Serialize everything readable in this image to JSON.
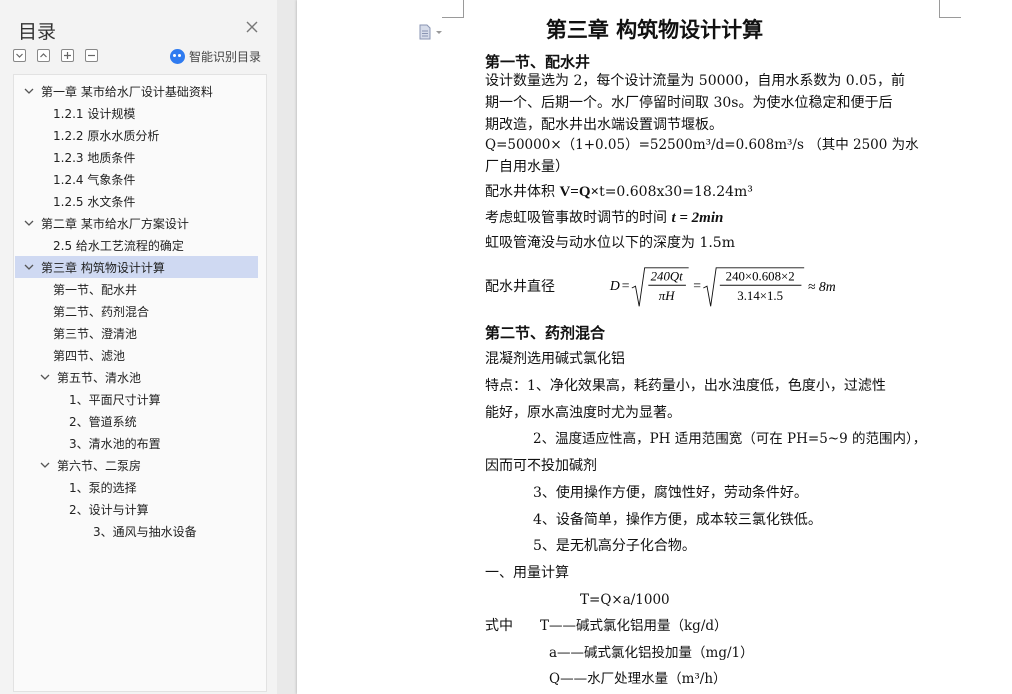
{
  "toc": {
    "title": "目录",
    "smart_label": "智能识别目录",
    "items": [
      {
        "label": "第一章   某市给水厂设计基础资料",
        "level": 0,
        "chevron": "down",
        "selected": false
      },
      {
        "label": "1.2.1 设计规模",
        "level": 1,
        "chevron": "",
        "selected": false
      },
      {
        "label": "1.2.2 原水水质分析",
        "level": 1,
        "chevron": "",
        "selected": false
      },
      {
        "label": "1.2.3 地质条件",
        "level": 1,
        "chevron": "",
        "selected": false
      },
      {
        "label": "1.2.4 气象条件",
        "level": 1,
        "chevron": "",
        "selected": false
      },
      {
        "label": "1.2.5 水文条件",
        "level": 1,
        "chevron": "",
        "selected": false
      },
      {
        "label": "第二章   某市给水厂方案设计",
        "level": 0,
        "chevron": "down",
        "selected": false
      },
      {
        "label": "2.5 给水工艺流程的确定",
        "level": 1,
        "chevron": "",
        "selected": false
      },
      {
        "label": "第三章  构筑物设计计算",
        "level": 0,
        "chevron": "down",
        "selected": true
      },
      {
        "label": "第一节、配水井",
        "level": 1,
        "chevron": "",
        "selected": false
      },
      {
        "label": "第二节、药剂混合",
        "level": 1,
        "chevron": "",
        "selected": false
      },
      {
        "label": "第三节、澄清池",
        "level": 1,
        "chevron": "",
        "selected": false
      },
      {
        "label": "第四节、滤池",
        "level": 1,
        "chevron": "",
        "selected": false
      },
      {
        "label": "第五节、清水池",
        "level": 1,
        "chevron": "down",
        "selected": false
      },
      {
        "label": "1、平面尺寸计算",
        "level": 2,
        "chevron": "",
        "selected": false
      },
      {
        "label": "2、管道系统",
        "level": 2,
        "chevron": "",
        "selected": false
      },
      {
        "label": "3、清水池的布置",
        "level": 2,
        "chevron": "",
        "selected": false
      },
      {
        "label": "第六节、二泵房",
        "level": 1,
        "chevron": "down",
        "selected": false
      },
      {
        "label": "1、泵的选择",
        "level": 2,
        "chevron": "",
        "selected": false
      },
      {
        "label": "2、设计与计算",
        "level": 2,
        "chevron": "",
        "selected": false
      },
      {
        "label": "3、通风与抽水设备",
        "level": 3,
        "chevron": "",
        "selected": false
      }
    ]
  },
  "doc": {
    "chapter_title": "第三章  构筑物设计计算",
    "section1_title": "第一节、配水井",
    "p1_l1": "设计数量选为 2，每个设计流量为 50000，自用水系数为 0.05，前",
    "p1_l2": "期一个、后期一个。水厂停留时间取 30s。为使水位稳定和便于后",
    "p1_l3": "期改造，配水井出水端设置调节堰板。",
    "q_l1": " Q=50000×（1+0.05）=52500m³/d=0.608m³/s （其中 2500 为水",
    "q_l2": "厂自用水量）",
    "volume_prefix": " 配水井体积 ",
    "volume_math": "V=Q×",
    "volume_rest": "t=0.608x30=18.24m³",
    "siphon_time_prefix": "考虑虹吸管事故时调节的时间 ",
    "siphon_time_math": "t = 2min",
    "siphon_depth": "虹吸管淹没与动水位以下的深度为 1.5m",
    "diameter_prefix": "配水井直径",
    "formula": {
      "lhs": "D",
      "eq": "=",
      "num1": "240Qt",
      "den1": "πH",
      "num2": "240×0.608×2",
      "den2": "3.14×1.5",
      "approx": "≈ 8m"
    },
    "section2_title": "第二节、药剂混合",
    "coagulant": "混凝剂选用碱式氯化铝",
    "feature_l1": "特点：1、净化效果高，耗药量小，出水浊度低，色度小，过滤性",
    "feature_l2": "能好，原水高浊度时尤为显著。",
    "feature2_l1": "2、温度适应性高，PH 适用范围宽（可在 PH=5~9 的范围内），",
    "feature2_l2": "因而可不投加碱剂",
    "feature3": "3、使用操作方便，腐蚀性好，劳动条件好。",
    "feature4": "4、设备简单，操作方便，成本较三氯化铁低。",
    "feature5": "5、是无机高分子化合物。",
    "dosage_title": "一、用量计算",
    "dosage_formula": "T=Q×a/1000",
    "where_prefix": "式中",
    "where_T": "T——碱式氯化铝用量（kg/d）",
    "where_a": "a——碱式氯化铝投加量（mg/1）",
    "where_Q": "Q——水厂处理水量（m³/h）"
  }
}
